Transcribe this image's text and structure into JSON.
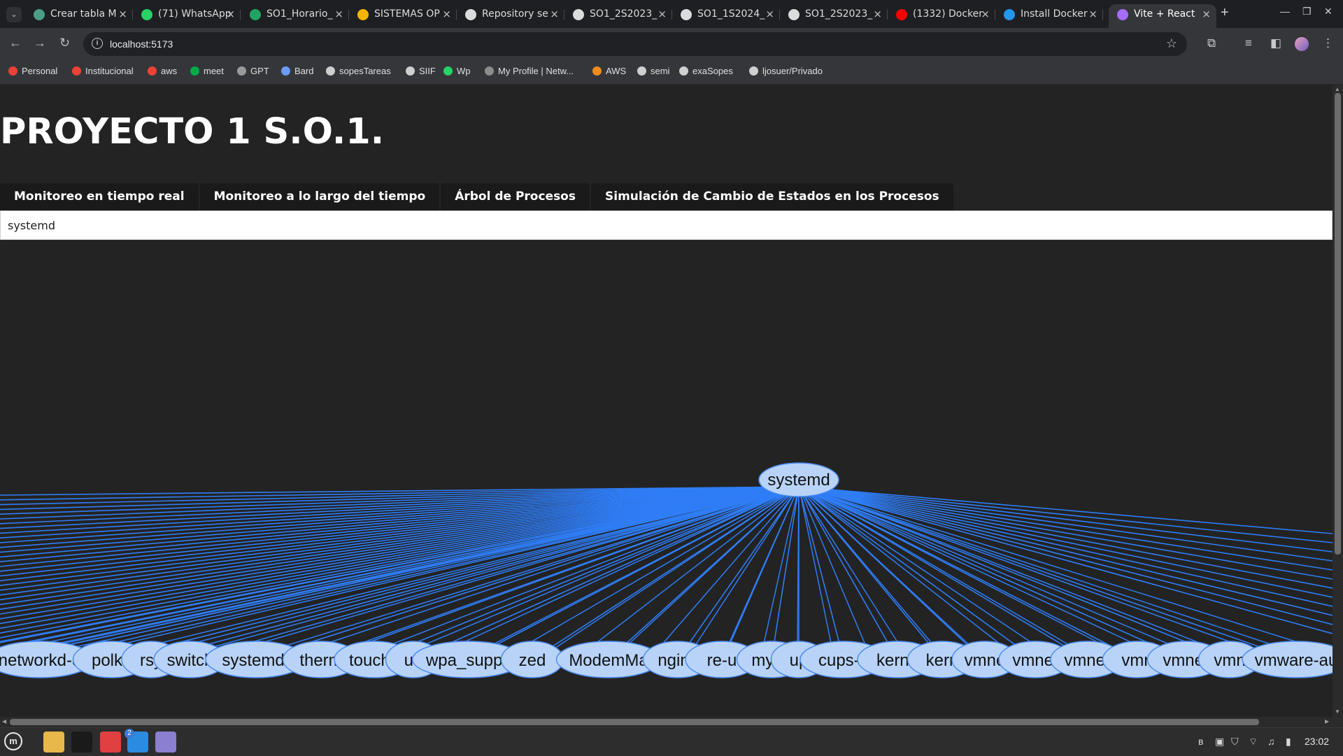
{
  "browser": {
    "tabs": [
      {
        "title": "Crear tabla M",
        "icon": "chatgpt-icon",
        "color": "#4a9e88"
      },
      {
        "title": "(71) WhatsApp",
        "icon": "whatsapp-icon",
        "color": "#25d366"
      },
      {
        "title": "SO1_Horario_",
        "icon": "sheets-icon",
        "color": "#1fa463"
      },
      {
        "title": "SISTEMAS OP",
        "icon": "slides-icon",
        "color": "#f4b400"
      },
      {
        "title": "Repository se",
        "icon": "github-icon",
        "color": "#dcdcdc"
      },
      {
        "title": "SO1_2S2023_",
        "icon": "github-icon",
        "color": "#dcdcdc"
      },
      {
        "title": "SO1_1S2024_",
        "icon": "github-icon",
        "color": "#dcdcdc"
      },
      {
        "title": "SO1_2S2023_",
        "icon": "github-icon",
        "color": "#dcdcdc"
      },
      {
        "title": "(1332) Docker",
        "icon": "youtube-icon",
        "color": "#ff0000"
      },
      {
        "title": "Install Docker",
        "icon": "docker-icon",
        "color": "#2496ed"
      },
      {
        "title": "Vite + React",
        "icon": "vite-icon",
        "color": "#a56cff",
        "active": true
      }
    ],
    "url": "localhost:5173",
    "bookmarks": [
      {
        "label": "Personal",
        "icon": "gmail-icon",
        "color": "#ea4335"
      },
      {
        "label": "Institucional",
        "icon": "gmail-icon",
        "color": "#ea4335"
      },
      {
        "label": "aws",
        "icon": "gmail-icon",
        "color": "#ea4335"
      },
      {
        "label": "meet",
        "icon": "meet-icon",
        "color": "#00ac47"
      },
      {
        "label": "GPT",
        "icon": "chatgpt-icon",
        "color": "#9a9a9a"
      },
      {
        "label": "Bard",
        "icon": "bard-icon",
        "color": "#6a9cf5"
      },
      {
        "label": "sopesTareas",
        "icon": "github-icon",
        "color": "#cfcfcf"
      },
      {
        "label": "SIIF",
        "icon": "globe-icon",
        "color": "#cfcfcf"
      },
      {
        "label": "Wp",
        "icon": "whatsapp-icon",
        "color": "#25d366"
      },
      {
        "label": "My Profile | Netw...",
        "icon": "network-icon",
        "color": "#8c8c8c"
      },
      {
        "label": "AWS",
        "icon": "aws-icon",
        "color": "#f08c1e"
      },
      {
        "label": "semi",
        "icon": "github-icon",
        "color": "#cfcfcf"
      },
      {
        "label": "exaSopes",
        "icon": "github-icon",
        "color": "#cfcfcf"
      },
      {
        "label": "ljosuer/Privado",
        "icon": "github-icon",
        "color": "#cfcfcf"
      }
    ]
  },
  "app": {
    "title": "PROYECTO 1 S.O.1.",
    "nav": [
      "Monitoreo en tiempo real",
      "Monitoreo a lo largo del tiempo",
      "Árbol de Procesos",
      "Simulación de Cambio de Estados en los Procesos"
    ],
    "selected_process": "systemd"
  },
  "tree": {
    "root": "systemd",
    "edge_color": "#2f7df6",
    "node_fill": "#b8d3f7",
    "node_stroke": "#4d8bf2",
    "offscreen_left_edges": 40,
    "offscreen_right_edges": 12,
    "children": [
      "networkd-d",
      "polkit",
      "rsy",
      "switch",
      "systemd-",
      "therm",
      "touche",
      "ud",
      "wpa_suppli",
      "zed",
      "ModemMa",
      "nginx",
      "re-u",
      "mysq",
      "up",
      "cups-b",
      "kerne",
      "kern",
      "vmne",
      "vmnet",
      "vmnet",
      "vmn",
      "vmnet",
      "vmn",
      "vmware-au"
    ]
  },
  "taskbar": {
    "apps": [
      {
        "name": "files-icon",
        "color": "#e8b84a"
      },
      {
        "name": "terminal-icon",
        "color": "#1a1a1a"
      },
      {
        "name": "chrome-icon",
        "color": "#e04040"
      },
      {
        "name": "vscode-icon",
        "color": "#2a8be0",
        "badge": "2"
      },
      {
        "name": "text-editor-icon",
        "color": "#8a7fd0"
      }
    ],
    "time": "23:02"
  }
}
